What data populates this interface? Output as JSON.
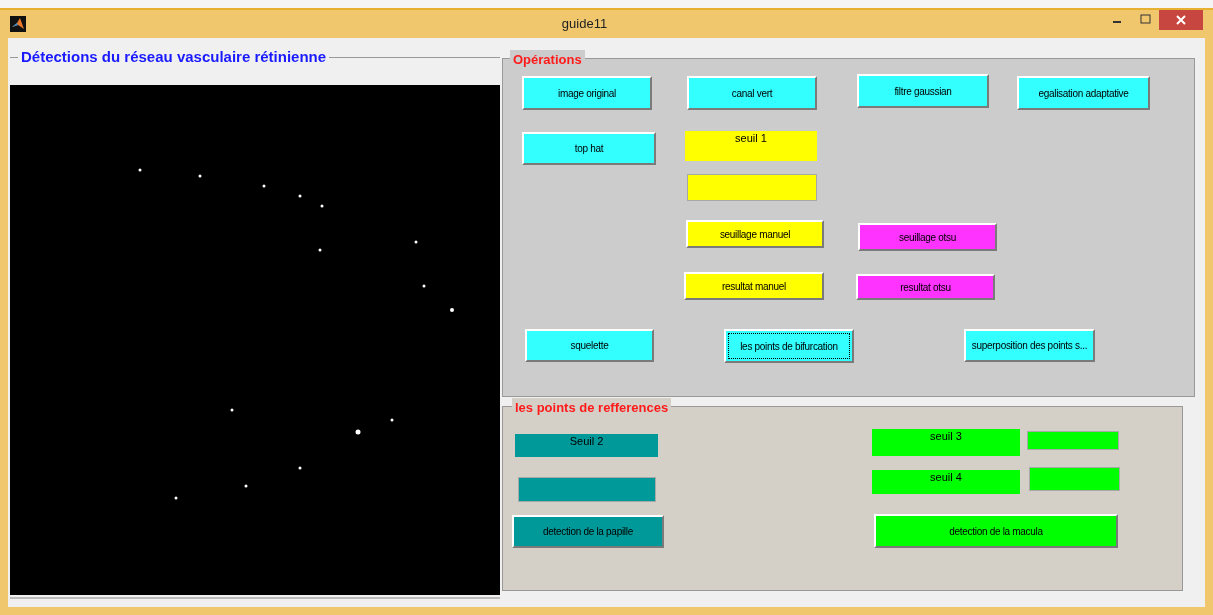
{
  "window": {
    "title": "guide11"
  },
  "image_panel": {
    "title": "Détections  du réseau vasculaire rétinienne"
  },
  "operations": {
    "title": "Opérations",
    "rows": [
      [
        {
          "kind": "button",
          "label": "image original",
          "color": "#33ffff",
          "focused": false
        },
        {
          "kind": "button",
          "label": "canal vert",
          "color": "#33ffff",
          "focused": false
        },
        {
          "kind": "button",
          "label": "filtre gaussian",
          "color": "#33ffff",
          "focused": false
        },
        {
          "kind": "button",
          "label": "egalisation adaptative",
          "color": "#33ffff",
          "focused": false
        }
      ],
      [
        {
          "kind": "button",
          "label": "top hat",
          "color": "#33ffff",
          "focused": false
        },
        {
          "kind": "label",
          "label": "seuil 1",
          "color": "#ffff00"
        }
      ],
      [
        {
          "kind": "field",
          "color": "#ffff00"
        }
      ],
      [
        {
          "kind": "button",
          "label": "seuillage manuel",
          "color": "#ffff00",
          "focused": false
        },
        {
          "kind": "button",
          "label": "seuillage otsu",
          "color": "#ff33ff",
          "focused": false
        }
      ],
      [
        {
          "kind": "button",
          "label": "resultat manuel",
          "color": "#ffff00",
          "focused": false
        },
        {
          "kind": "button",
          "label": "resultat otsu",
          "color": "#ff33ff",
          "focused": false
        }
      ],
      [
        {
          "kind": "button",
          "label": "squelette",
          "color": "#33ffff",
          "focused": false
        },
        {
          "kind": "button",
          "label": "les points de bifurcation",
          "color": "#33ffff",
          "focused": true
        },
        {
          "kind": "button",
          "label": "superposition des points s...",
          "color": "#33ffff",
          "focused": false
        }
      ]
    ]
  },
  "references": {
    "title": "les points de refferences",
    "rows": [
      [
        {
          "kind": "label",
          "label": "Seuil 2",
          "color": "#009999"
        },
        {
          "kind": "label",
          "label": "seuil 3",
          "color": "#00ff00"
        },
        {
          "kind": "field",
          "color": "#00ff00"
        }
      ],
      [
        {
          "kind": "field",
          "color": "#009999"
        },
        {
          "kind": "label",
          "label": "seuil 4",
          "color": "#00ff00"
        },
        {
          "kind": "field",
          "color": "#00ff00"
        }
      ],
      [
        {
          "kind": "button",
          "label": "detection de la papille",
          "color": "#009999",
          "focused": false
        },
        {
          "kind": "button",
          "label": "detection de la macula",
          "color": "#00ff00",
          "focused": false
        }
      ]
    ]
  }
}
